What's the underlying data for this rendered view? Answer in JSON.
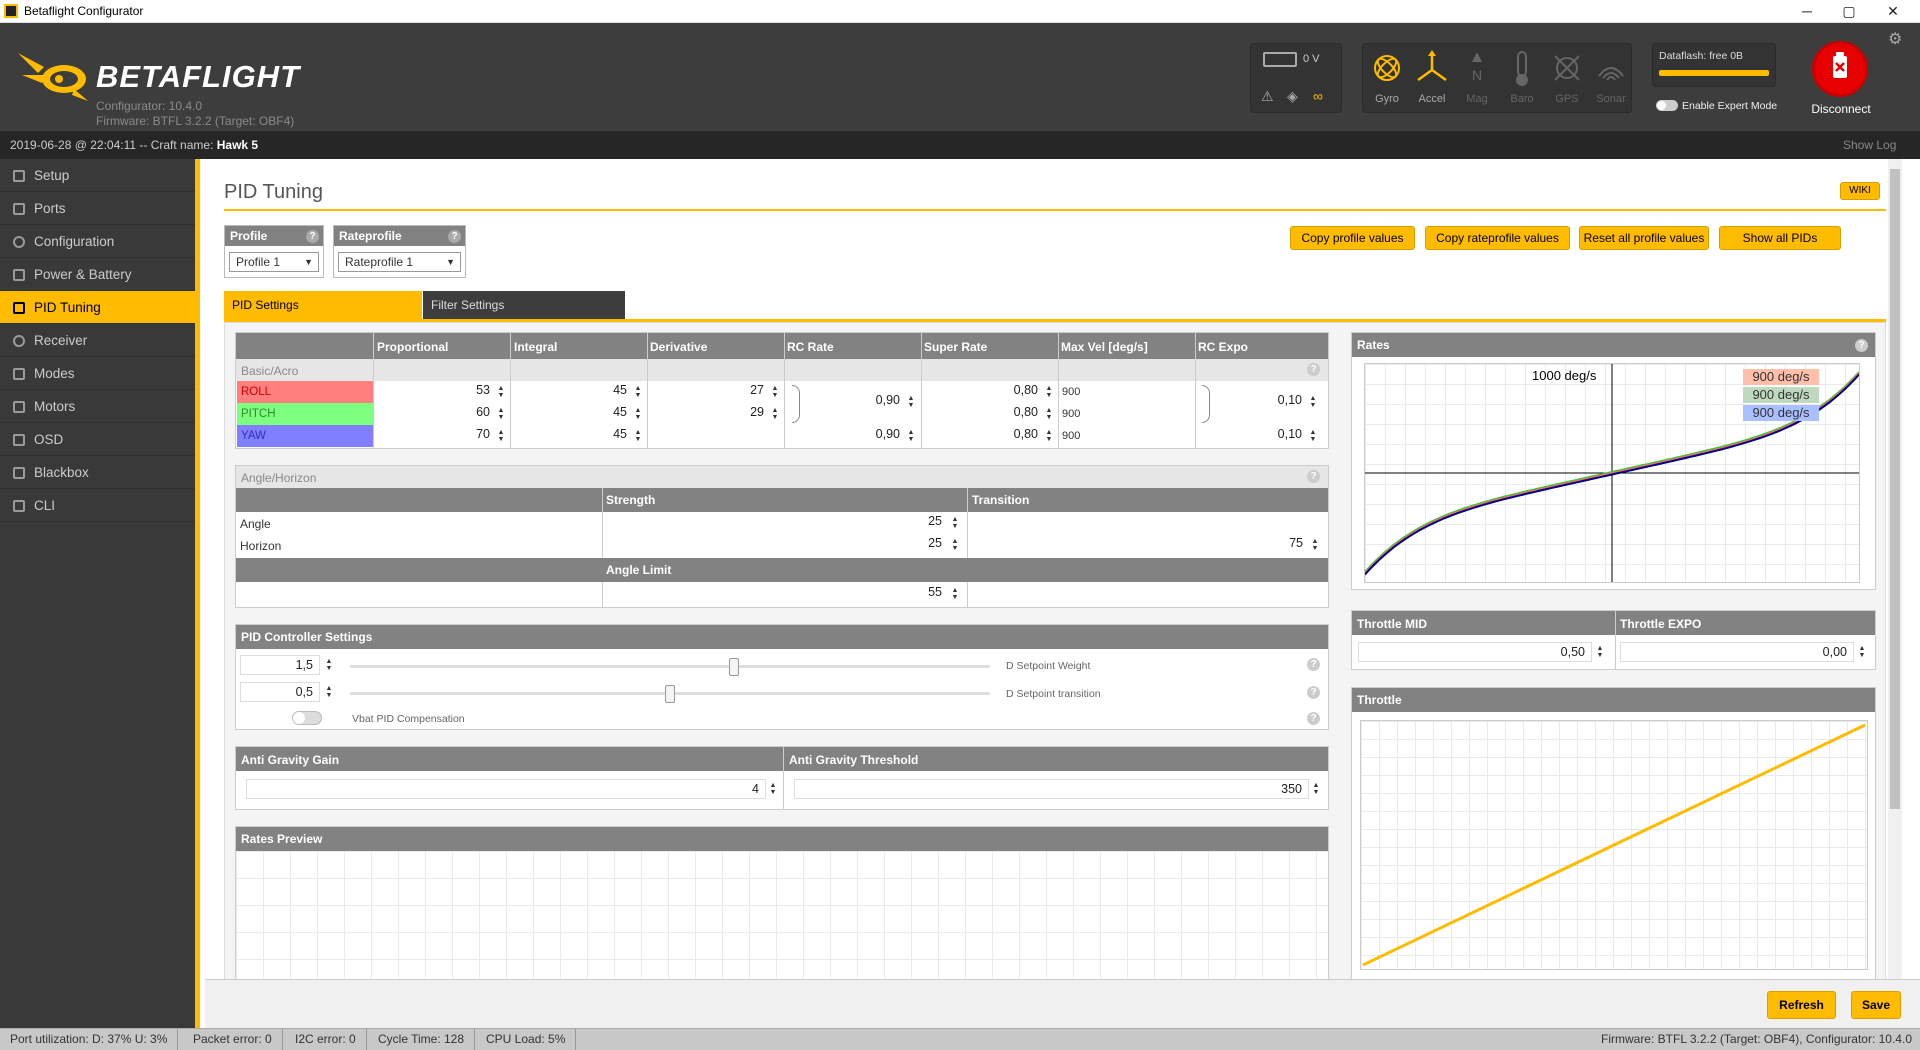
{
  "window": {
    "title": "Betaflight Configurator",
    "minimize": "─",
    "maximize": "▢",
    "close": "✕"
  },
  "header": {
    "logo": "BETAFLIGHT",
    "configurator_version": "Configurator: 10.4.0",
    "firmware": "Firmware: BTFL 3.2.2 (Target: OBF4)",
    "battery_voltage": "0 V",
    "sensors": [
      {
        "label": "Gyro",
        "active": true
      },
      {
        "label": "Accel",
        "active": true
      },
      {
        "label": "Mag",
        "active": false
      },
      {
        "label": "Baro",
        "active": false
      },
      {
        "label": "GPS",
        "active": false
      },
      {
        "label": "Sonar",
        "active": false
      }
    ],
    "dataflash": "Dataflash: free 0B",
    "expert_mode": "Enable Expert Mode",
    "disconnect": "Disconnect"
  },
  "status": {
    "text": "2019-06-28 @ 22:04:11 -- Craft name:",
    "craft": "Hawk 5",
    "show_log": "Show Log"
  },
  "sidebar": {
    "items": [
      {
        "label": "Setup",
        "active": false
      },
      {
        "label": "Ports",
        "active": false
      },
      {
        "label": "Configuration",
        "active": false
      },
      {
        "label": "Power & Battery",
        "active": false
      },
      {
        "label": "PID Tuning",
        "active": true
      },
      {
        "label": "Receiver",
        "active": false
      },
      {
        "label": "Modes",
        "active": false
      },
      {
        "label": "Motors",
        "active": false
      },
      {
        "label": "OSD",
        "active": false
      },
      {
        "label": "Blackbox",
        "active": false
      },
      {
        "label": "CLI",
        "active": false
      }
    ]
  },
  "page": {
    "title": "PID Tuning",
    "wiki": "WIKI",
    "profile_label": "Profile",
    "profile_value": "Profile 1",
    "rateprofile_label": "Rateprofile",
    "rateprofile_value": "Rateprofile 1",
    "buttons": {
      "copy_profile": "Copy profile values",
      "copy_rateprofile": "Copy rateprofile values",
      "reset_all": "Reset all profile values",
      "show_all": "Show all PIDs"
    },
    "tabs": {
      "pid": "PID Settings",
      "filter": "Filter Settings"
    }
  },
  "pid_table": {
    "headers": [
      "Proportional",
      "Integral",
      "Derivative",
      "RC Rate",
      "Super Rate",
      "Max Vel [deg/s]",
      "RC Expo"
    ],
    "section": "Basic/Acro",
    "rows": [
      {
        "name": "ROLL",
        "color": "#ff7f7f",
        "p": "53",
        "i": "45",
        "d": "27",
        "rc_rate": "0,90",
        "super": "0,80",
        "maxvel": "900",
        "expo": "0,10"
      },
      {
        "name": "PITCH",
        "color": "#7fff7f",
        "p": "60",
        "i": "45",
        "d": "29",
        "rc_rate": "",
        "super": "0,80",
        "maxvel": "900",
        "expo": ""
      },
      {
        "name": "YAW",
        "color": "#7f7fff",
        "p": "70",
        "i": "45",
        "d": "",
        "rc_rate": "0,90",
        "super": "0,80",
        "maxvel": "900",
        "expo": "0,10"
      }
    ]
  },
  "angle_horizon": {
    "title": "Angle/Horizon",
    "strength": "Strength",
    "transition": "Transition",
    "angle_label": "Angle",
    "angle_strength": "25",
    "horizon_label": "Horizon",
    "horizon_strength": "25",
    "horizon_transition": "75",
    "angle_limit_label": "Angle Limit",
    "angle_limit": "55"
  },
  "pid_controller": {
    "title": "PID Controller Settings",
    "setpoint_weight": "1,5",
    "setpoint_weight_label": "D Setpoint Weight",
    "setpoint_weight_level": 0.6,
    "setpoint_transition": "0,5",
    "setpoint_transition_label": "D Setpoint transition",
    "setpoint_transition_level": 0.5,
    "vbat_label": "Vbat PID Compensation"
  },
  "anti_gravity": {
    "gain_label": "Anti Gravity Gain",
    "gain": "4",
    "threshold_label": "Anti Gravity Threshold",
    "threshold": "350"
  },
  "rates_preview": {
    "title": "Rates Preview"
  },
  "rates_panel": {
    "title": "Rates",
    "max_label": "1000 deg/s",
    "legend": [
      {
        "text": "900 deg/s",
        "color": "#ffbfaa"
      },
      {
        "text": "900 deg/s",
        "color": "#bfd9bf"
      },
      {
        "text": "900 deg/s",
        "color": "#aabfff"
      }
    ]
  },
  "throttle": {
    "mid_label": "Throttle MID",
    "mid": "0,50",
    "expo_label": "Throttle EXPO",
    "expo": "0,00",
    "chart_title": "Throttle"
  },
  "actions": {
    "refresh": "Refresh",
    "save": "Save"
  },
  "footer": {
    "port_util": "Port utilization: D: 37% U: 3%",
    "packet_error": "Packet error: 0",
    "i2c_error": "I2C error: 0",
    "cycle_time": "Cycle Time: 128",
    "cpu_load": "CPU Load: 5%",
    "firmware": "Firmware: BTFL 3.2.2 (Target: OBF4), Configurator: 10.4.0"
  }
}
